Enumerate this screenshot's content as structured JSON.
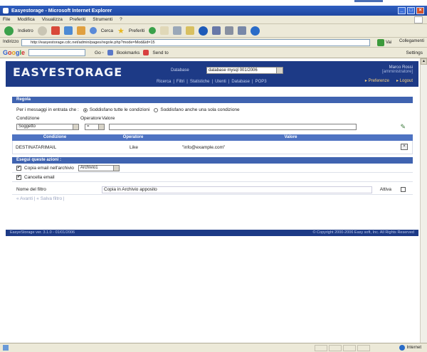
{
  "browser": {
    "title": "Easyestorage - Microsoft Internet Explorer",
    "menu": [
      "File",
      "Modifica",
      "Visualizza",
      "Preferiti",
      "Strumenti",
      "?"
    ],
    "toolbar": {
      "back": "Indietro",
      "search": "Cerca",
      "favorites": "Preferiti"
    },
    "address_label": "Indirizzo",
    "address": "http://easyestorage.cdc.net/admin/pages/regole.php?mode=Mod&id=15",
    "go": "Vai",
    "links": "Collegamenti",
    "google_bar": {
      "logo": "Google",
      "bookmarks": "Bookmarks",
      "send": "Send to",
      "settings": "Settings"
    },
    "status": "",
    "zone": "Internet"
  },
  "app": {
    "logo": "EASYESTORAGE",
    "db_label": "Database",
    "db_value": "database mysql 001/2006",
    "nav": [
      "Ricerca",
      "Filtri",
      "Statistiche",
      "Utenti",
      "Database",
      "POP3"
    ],
    "user_name": "Marco Rossi",
    "user_role": "[amministratore]",
    "preferences": "Preferenze",
    "logout": "Logout"
  },
  "rules": {
    "section_title": "Regola",
    "message_prompt": "Per i messaggi in entrata che :",
    "radio_all": "Soddisfano tutte le condizioni",
    "radio_any": "Soddisfano anche una sola condizione",
    "col_condition": "Condizione",
    "col_operator": "Operatore",
    "col_value": "Valore",
    "condition_value": "Soggetto",
    "operator_value": "=",
    "table": {
      "headers": [
        "Condizione",
        "Operatore",
        "Valore"
      ],
      "rows": [
        {
          "condition": "DESTINATARIMAIL",
          "operator": "Like",
          "value": "\"info@example.com\""
        }
      ]
    },
    "actions_title": "Esegui queste azioni :",
    "action_copy_label": "Copia email nell'archivio",
    "archive_value": "Archivio1",
    "action_delete_label": "Cancella email",
    "filter_name_label": "Nome del filtro",
    "filter_name_value": "Copia in Archivio apposito",
    "active_label": "Attiva",
    "links": "« Avanti | « Salva filtro |"
  },
  "footer": {
    "left": "EasyeStorage  ver. 3.1.0 - 01/01/2006",
    "right": "© Copyright 2000-2006 Easy soft, Inc. All Rights Reserved"
  },
  "colors": {
    "brand": "#1d3a86",
    "section": "#3f63b0",
    "chrome": "#ece9d8"
  }
}
